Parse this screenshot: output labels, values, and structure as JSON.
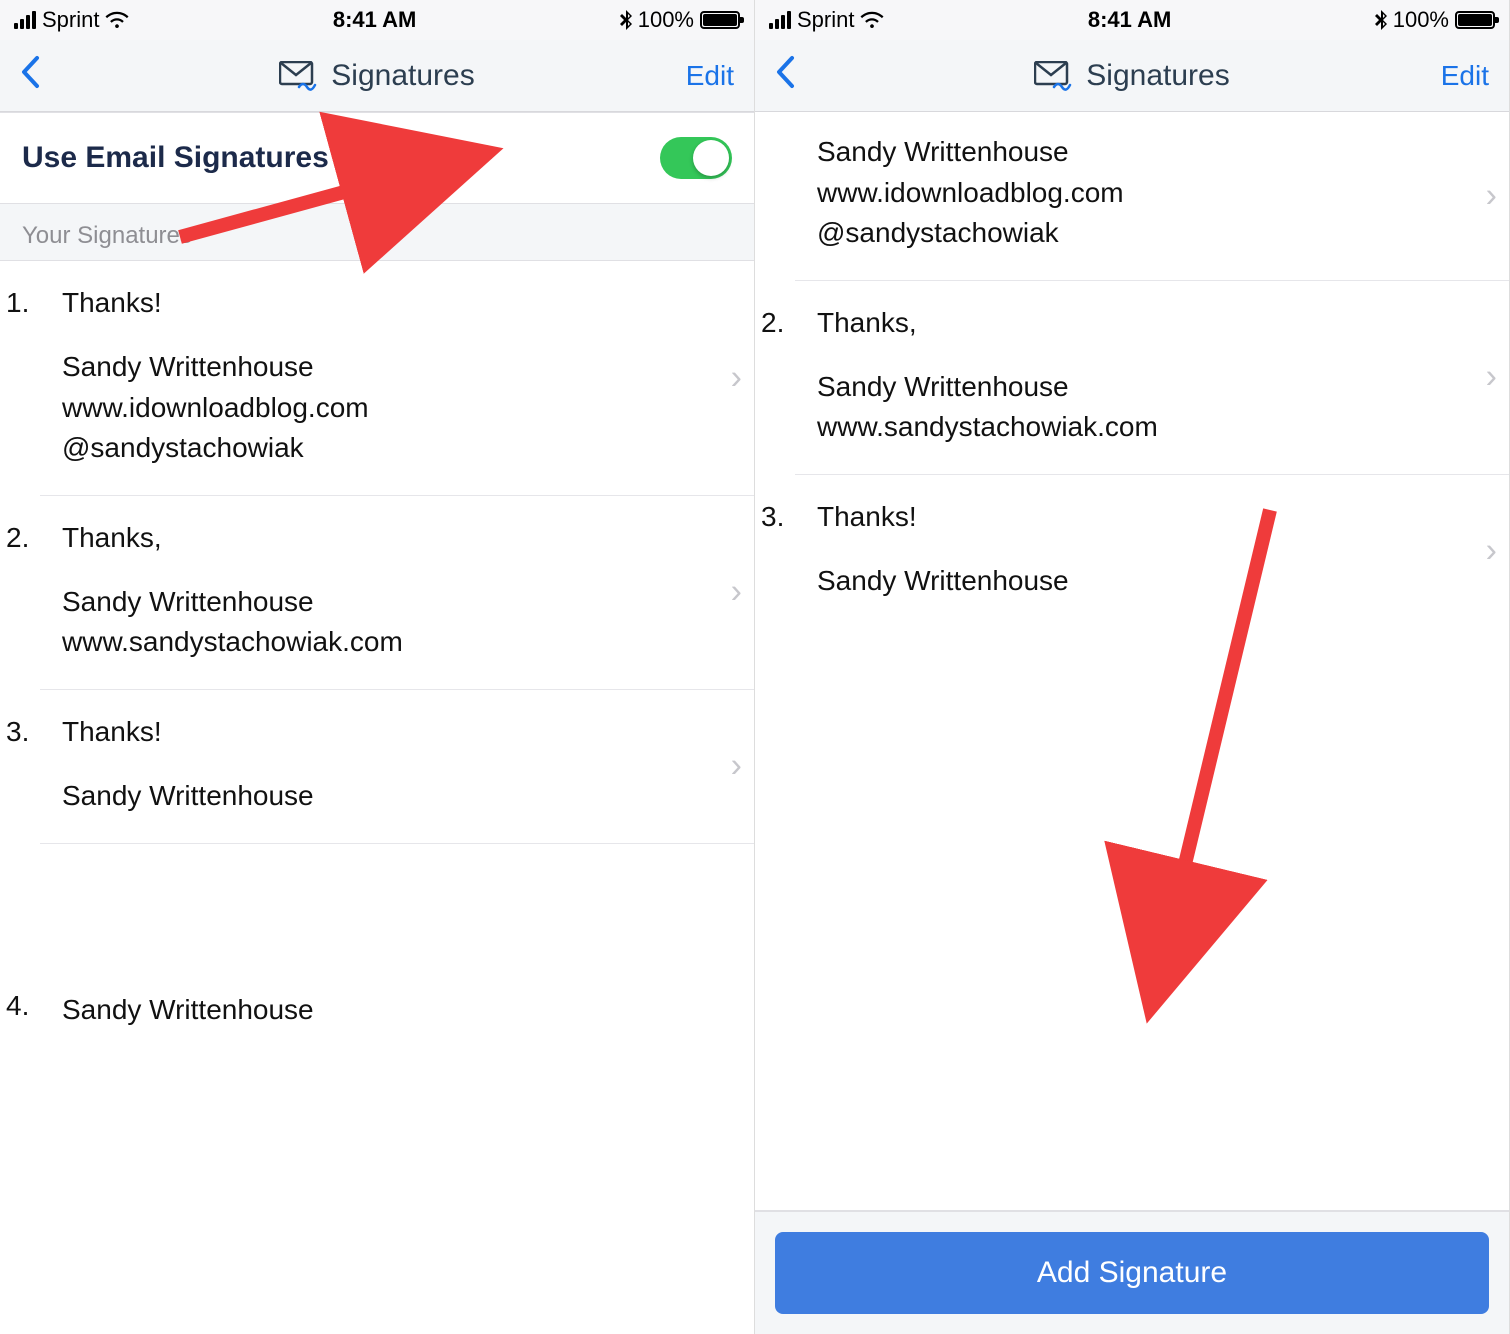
{
  "status": {
    "carrier": "Sprint",
    "time": "8:41 AM",
    "battery_pct": "100%",
    "bluetooth": true
  },
  "nav": {
    "title": "Signatures",
    "edit": "Edit"
  },
  "toggle": {
    "label": "Use Email Signatures",
    "on": true
  },
  "section": {
    "your_signatures": "Your Signatures"
  },
  "left_signatures": [
    {
      "num": "1.",
      "greet": "Thanks!",
      "lines": [
        "Sandy Writtenhouse",
        "www.idownloadblog.com",
        "@sandystachowiak"
      ]
    },
    {
      "num": "2.",
      "greet": "Thanks,",
      "lines": [
        "Sandy Writtenhouse",
        "www.sandystachowiak.com"
      ]
    },
    {
      "num": "3.",
      "greet": "Thanks!",
      "lines": [
        "Sandy Writtenhouse"
      ]
    },
    {
      "num": "4.",
      "greet": "",
      "lines": [
        "Sandy Writtenhouse"
      ]
    }
  ],
  "right_signatures": [
    {
      "num": "",
      "greet": "",
      "lines": [
        "Sandy Writtenhouse",
        "www.idownloadblog.com",
        "@sandystachowiak"
      ]
    },
    {
      "num": "2.",
      "greet": "Thanks,",
      "lines": [
        "Sandy Writtenhouse",
        "www.sandystachowiak.com"
      ]
    },
    {
      "num": "3.",
      "greet": "Thanks!",
      "lines": [
        "Sandy Writtenhouse"
      ]
    }
  ],
  "add_signature_label": "Add Signature"
}
